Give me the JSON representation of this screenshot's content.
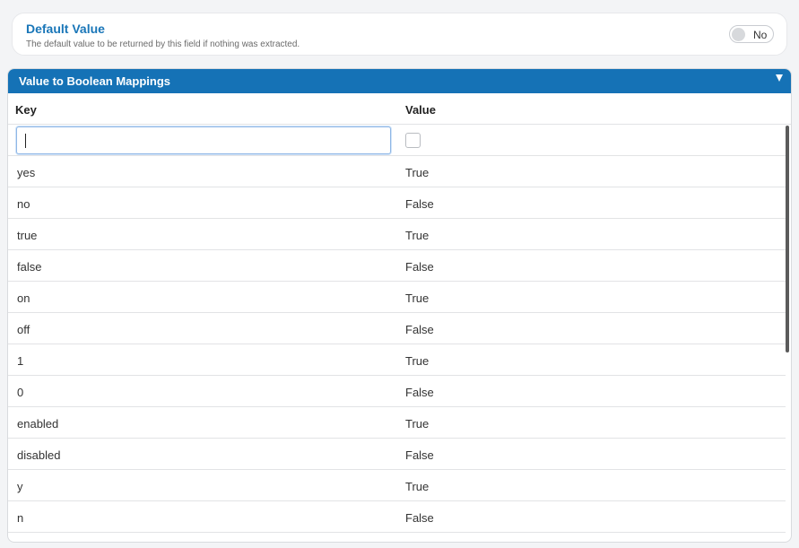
{
  "default_value": {
    "title": "Default Value",
    "description": "The default value to be returned by this field if nothing was extracted.",
    "toggle_label": "No"
  },
  "mappings": {
    "title": "Value to Boolean Mappings",
    "columns": {
      "key": "Key",
      "value": "Value"
    },
    "new_key_value": "",
    "rows": [
      {
        "key": "yes",
        "value": "True"
      },
      {
        "key": "no",
        "value": "False"
      },
      {
        "key": "true",
        "value": "True"
      },
      {
        "key": "false",
        "value": "False"
      },
      {
        "key": "on",
        "value": "True"
      },
      {
        "key": "off",
        "value": "False"
      },
      {
        "key": "1",
        "value": "True"
      },
      {
        "key": "0",
        "value": "False"
      },
      {
        "key": "enabled",
        "value": "True"
      },
      {
        "key": "disabled",
        "value": "False"
      },
      {
        "key": "y",
        "value": "True"
      },
      {
        "key": "n",
        "value": "False"
      }
    ]
  },
  "colors": {
    "accent": "#1572b6",
    "title_blue": "#1976b8"
  }
}
